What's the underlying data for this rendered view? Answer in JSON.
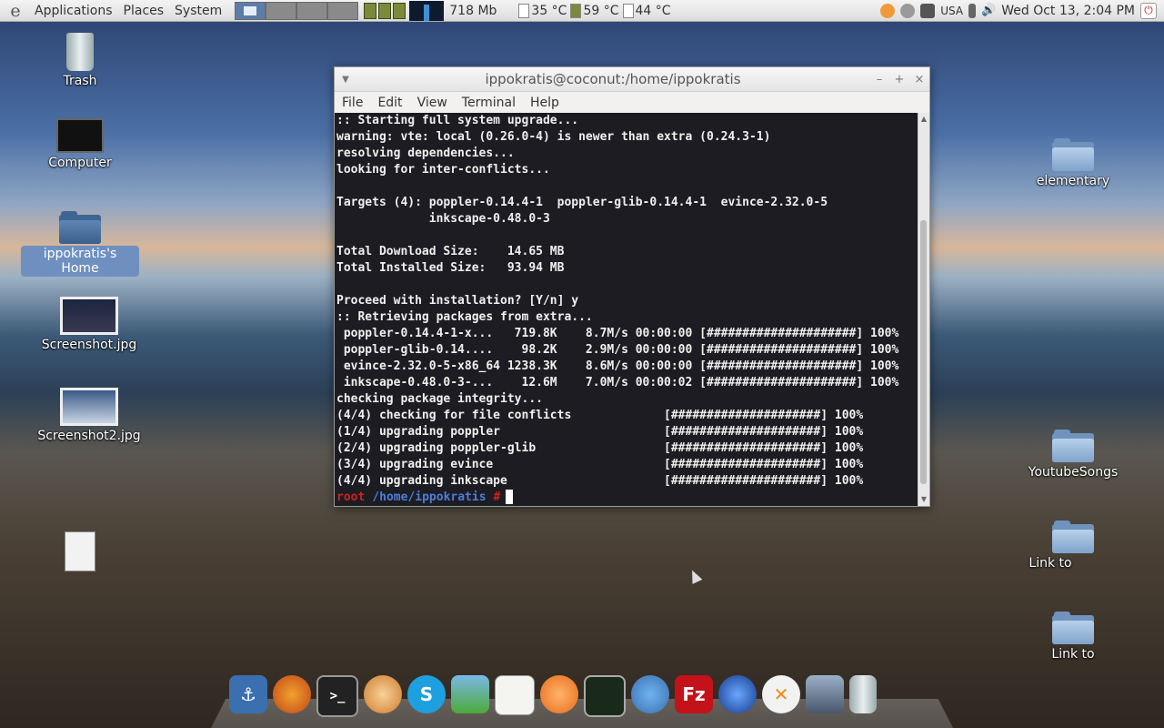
{
  "panel": {
    "menus": [
      "Applications",
      "Places",
      "System"
    ],
    "memory": "718 Mb",
    "temps": [
      "35 °C",
      "59 °C",
      "44 °C"
    ],
    "keyboard": "USA",
    "clock": "Wed Oct 13,  2:04 PM",
    "icons": [
      "distro-logo-icon",
      "cpu-chip-icon",
      "network-graph-icon",
      "battery-icon",
      "volume-icon"
    ]
  },
  "desktop": {
    "left_icons": [
      {
        "label": "Trash",
        "icon": "trash-icon"
      },
      {
        "label": "Computer",
        "icon": "computer-icon"
      },
      {
        "label": "ippokratis's Home",
        "icon": "home-folder-icon"
      },
      {
        "label": "Screenshot.jpg",
        "icon": "image-file-icon"
      },
      {
        "label": "Screenshot2.jpg",
        "icon": "image-file-icon"
      }
    ],
    "right_icons": [
      {
        "label": "elementary",
        "icon": "folder-icon"
      },
      {
        "label": "YoutubeSongs",
        "icon": "folder-icon"
      },
      {
        "label": "Link to",
        "icon": "folder-link-icon"
      },
      {
        "label": "Link to",
        "icon": "folder-link-icon"
      }
    ]
  },
  "terminal": {
    "title": "ippokratis@coconut:/home/ippokratis",
    "menu": [
      "File",
      "Edit",
      "View",
      "Terminal",
      "Help"
    ],
    "output": ":: Starting full system upgrade...\nwarning: vte: local (0.26.0-4) is newer than extra (0.24.3-1)\nresolving dependencies...\nlooking for inter-conflicts...\n\nTargets (4): poppler-0.14.4-1  poppler-glib-0.14.4-1  evince-2.32.0-5\n             inkscape-0.48.0-3\n\nTotal Download Size:    14.65 MB\nTotal Installed Size:   93.94 MB\n\nProceed with installation? [Y/n] y\n:: Retrieving packages from extra...\n poppler-0.14.4-1-x...   719.8K    8.7M/s 00:00:00 [#####################] 100%\n poppler-glib-0.14....    98.2K    2.9M/s 00:00:00 [#####################] 100%\n evince-2.32.0-5-x86_64 1238.3K    8.6M/s 00:00:00 [#####################] 100%\n inkscape-0.48.0-3-...    12.6M    7.0M/s 00:00:02 [#####################] 100%\nchecking package integrity...\n(4/4) checking for file conflicts             [#####################] 100%\n(1/4) upgrading poppler                       [#####################] 100%\n(2/4) upgrading poppler-glib                  [#####################] 100%\n(3/4) upgrading evince                        [#####################] 100%\n(4/4) upgrading inkscape                      [#####################] 100%",
    "prompt_user": "root",
    "prompt_path": "/home/ippokratis",
    "prompt_symbol": "#"
  },
  "dock": {
    "items": [
      "anchor-icon",
      "firefox-icon",
      "terminal-icon",
      "nautilus-shell-icon",
      "skype-icon",
      "people-icon",
      "text-editor-icon",
      "clementine-icon",
      "system-monitor-icon",
      "chromium-icon",
      "filezilla-icon",
      "google-earth-icon",
      "crossover-icon",
      "video-converter-icon",
      "trash-icon"
    ]
  },
  "colors": {
    "prompt_user": "#cc2222",
    "prompt_path": "#4c7ed8",
    "selection": "#6e8fc0"
  }
}
